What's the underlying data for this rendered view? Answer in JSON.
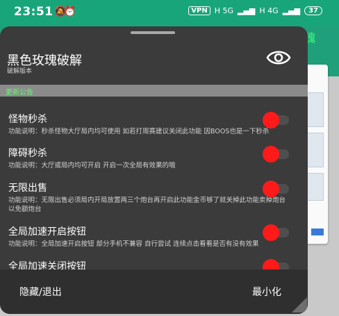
{
  "status_bar": {
    "time": "23:51",
    "vpn": "VPN",
    "net1": "H 5G",
    "net2": "H 4G",
    "battery": "37"
  },
  "background_app": {
    "title": "黑色玫瑰"
  },
  "menu": {
    "title": "黑色玫瑰破解",
    "subtitle": "破解版本",
    "notice": "更新公告",
    "items": [
      {
        "name": "怪物秒杀",
        "desc": "功能说明：秒杀怪物大厅局内均可使用 如若打周赛建议关闭此功能 因BOOS也是一下秒杀"
      },
      {
        "name": "障碍秒杀",
        "desc": "功能说明：大厅或局内均可开启 开启一次全局有效果的哦"
      },
      {
        "name": "无限出售",
        "desc": "功能说明：无限出售必须局内开局放置两三个炮台再开启此功能金币够了就关掉此功能卖掉炮台以免额炮台"
      },
      {
        "name": "全局加速开启按钮",
        "desc": "功能说明：全局加速开启按钮 部分手机不兼容 自行尝试 连续点击看看是否有没有效果"
      },
      {
        "name": "全局加速关闭按钮",
        "desc": ""
      }
    ],
    "hide_exit": "隐藏/退出",
    "minimize": "最小化",
    "toggle_color": "#ff1a1a"
  }
}
